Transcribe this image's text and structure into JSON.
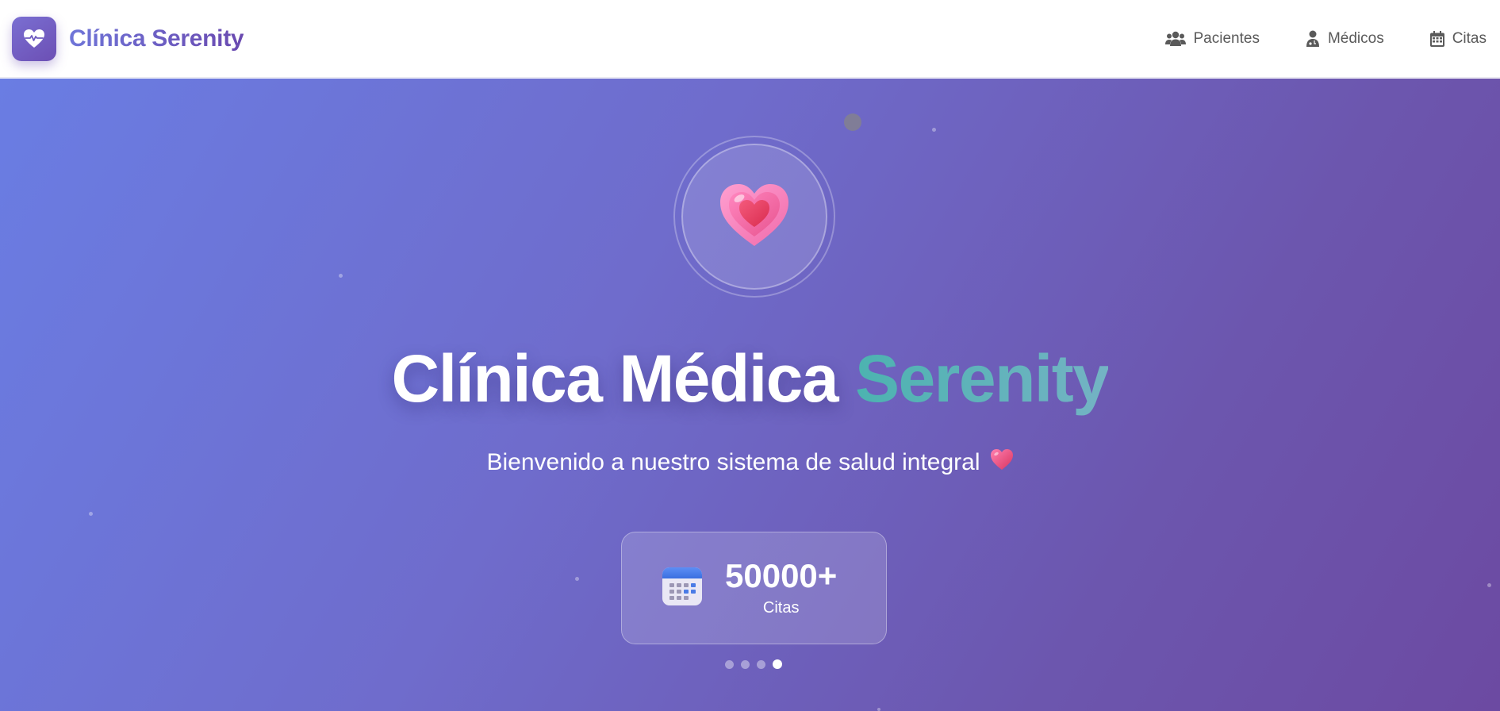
{
  "navbar": {
    "brand_name": "Clínica Serenity",
    "logo_icon": "heart-pulse-icon",
    "links": [
      {
        "label": "Pacientes",
        "icon": "users-icon"
      },
      {
        "label": "Médicos",
        "icon": "doctor-icon"
      },
      {
        "label": "Citas",
        "icon": "calendar-icon"
      }
    ]
  },
  "hero": {
    "title_part1": "Clínica",
    "title_part2": "Médica",
    "title_accent": "Serenity",
    "subtitle": "Bienvenido a nuestro sistema de salud integral",
    "emblem_icon": "heart-icon",
    "stat": {
      "value": "50000+",
      "label": "Citas",
      "icon": "calendar-icon"
    },
    "carousel": {
      "total": 4,
      "active_index": 3
    }
  },
  "colors": {
    "brand": "#6a4ab0",
    "hero_start": "#6a7de3",
    "hero_end": "#6c4aa2",
    "accent_teal": "#4cb3b0"
  }
}
